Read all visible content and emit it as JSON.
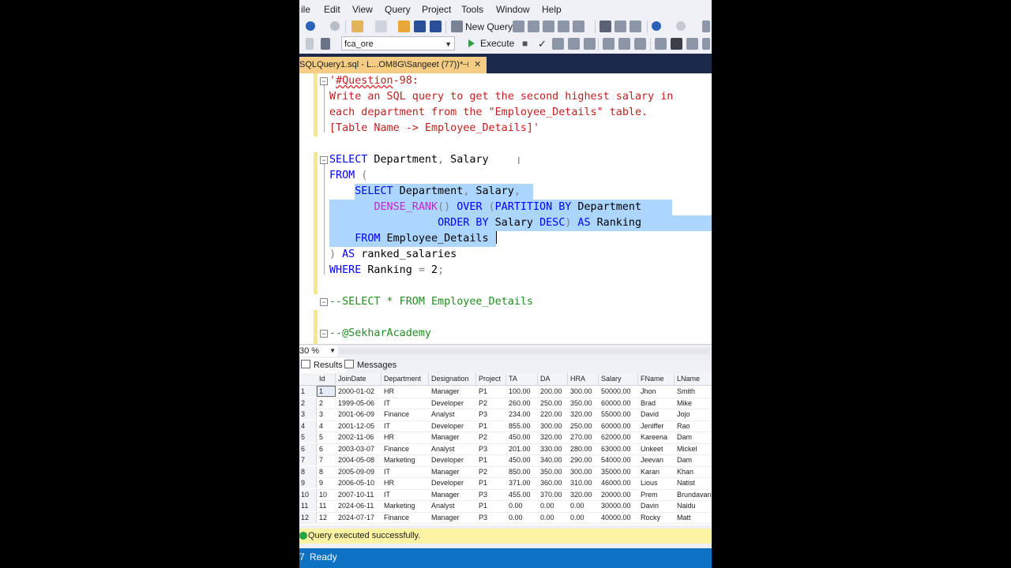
{
  "menu": {
    "items": [
      "ile",
      "Edit",
      "View",
      "Query",
      "Project",
      "Tools",
      "Window",
      "Help"
    ]
  },
  "toolbar": {
    "new_query_label": "New Query",
    "database": "fca_ore",
    "execute_label": "Execute",
    "icons": [
      "back-arrow",
      "forward-arrow",
      "new-file",
      "open-file",
      "save",
      "save-all",
      "new-query",
      "database-query",
      "mdx",
      "dmx",
      "xmla",
      "dax",
      "cut",
      "copy",
      "paste",
      "undo",
      "redo"
    ]
  },
  "document_tab": {
    "title": "SQLQuery1.sql - L...OM8G\\Sangeet (77))*"
  },
  "editor": {
    "lines": [
      {
        "segments": [
          {
            "t": "'",
            "c": "red"
          },
          {
            "t": "#Question",
            "c": "red-wavy"
          },
          {
            "t": "-98:",
            "c": "red"
          }
        ]
      },
      {
        "segments": [
          {
            "t": "Write an SQL query to get the second highest salary in",
            "c": "red"
          }
        ]
      },
      {
        "segments": [
          {
            "t": "each department from the \"Employee_Details\" table.",
            "c": "red"
          }
        ]
      },
      {
        "segments": [
          {
            "t": "[Table Name -> Employee_Details]'",
            "c": "red"
          }
        ]
      },
      {
        "segments": []
      },
      {
        "segments": [
          {
            "t": "SELECT",
            "c": "blue"
          },
          {
            "t": " Department",
            "c": "black"
          },
          {
            "t": ",",
            "c": "gray"
          },
          {
            "t": " Salary",
            "c": "black"
          }
        ]
      },
      {
        "segments": [
          {
            "t": "FROM",
            "c": "blue"
          },
          {
            "t": " (",
            "c": "gray"
          }
        ]
      },
      {
        "segments": [
          {
            "t": "    ",
            "c": "black"
          },
          {
            "t": "SELECT",
            "c": "blue"
          },
          {
            "t": " Department",
            "c": "black"
          },
          {
            "t": ",",
            "c": "gray"
          },
          {
            "t": " Salary",
            "c": "black"
          },
          {
            "t": ",",
            "c": "gray"
          }
        ]
      },
      {
        "segments": [
          {
            "t": "       ",
            "c": "black"
          },
          {
            "t": "DENSE_RANK",
            "c": "pink"
          },
          {
            "t": "()",
            "c": "gray"
          },
          {
            "t": " OVER",
            "c": "blue"
          },
          {
            "t": " (",
            "c": "gray"
          },
          {
            "t": "PARTITION BY",
            "c": "blue"
          },
          {
            "t": " Department",
            "c": "black"
          }
        ]
      },
      {
        "segments": [
          {
            "t": "                 ",
            "c": "black"
          },
          {
            "t": "ORDER BY",
            "c": "blue"
          },
          {
            "t": " Salary ",
            "c": "black"
          },
          {
            "t": "DESC",
            "c": "blue"
          },
          {
            "t": ")",
            "c": "gray"
          },
          {
            "t": " AS",
            "c": "blue"
          },
          {
            "t": " Ranking",
            "c": "black"
          }
        ]
      },
      {
        "segments": [
          {
            "t": "    ",
            "c": "black"
          },
          {
            "t": "FROM",
            "c": "blue"
          },
          {
            "t": " Employee_Details",
            "c": "black"
          }
        ]
      },
      {
        "segments": [
          {
            "t": ")",
            "c": "gray"
          },
          {
            "t": " AS",
            "c": "blue"
          },
          {
            "t": " ranked_salaries",
            "c": "black"
          }
        ]
      },
      {
        "segments": [
          {
            "t": "WHERE",
            "c": "blue"
          },
          {
            "t": " Ranking ",
            "c": "black"
          },
          {
            "t": "=",
            "c": "gray"
          },
          {
            "t": " 2",
            "c": "black"
          },
          {
            "t": ";",
            "c": "gray"
          }
        ]
      },
      {
        "segments": []
      },
      {
        "segments": [
          {
            "t": "--SELECT * FROM Employee_Details",
            "c": "green"
          }
        ]
      },
      {
        "segments": []
      },
      {
        "segments": [
          {
            "t": "--@SekharAcademy",
            "c": "green"
          }
        ]
      }
    ]
  },
  "zoom": {
    "value": "30 %"
  },
  "results_tabs": {
    "results": "Results",
    "messages": "Messages"
  },
  "grid": {
    "columns": [
      "Id",
      "JoinDate",
      "Department",
      "Designation",
      "Project",
      "TA",
      "DA",
      "HRA",
      "Salary",
      "FName",
      "LName"
    ],
    "rows": [
      [
        "1",
        "1",
        "2000-01-02",
        "HR",
        "Manager",
        "P1",
        "100.00",
        "200.00",
        "300.00",
        "50000.00",
        "Jhon",
        "Smith"
      ],
      [
        "2",
        "2",
        "1999-05-06",
        "IT",
        "Developer",
        "P2",
        "260.00",
        "250.00",
        "350.00",
        "60000.00",
        "Brad",
        "Mike"
      ],
      [
        "3",
        "3",
        "2001-06-09",
        "Finance",
        "Analyst",
        "P3",
        "234.00",
        "220.00",
        "320.00",
        "55000.00",
        "David",
        "Jojo"
      ],
      [
        "4",
        "4",
        "2001-12-05",
        "IT",
        "Developer",
        "P1",
        "855.00",
        "300.00",
        "250.00",
        "60000.00",
        "Jeniffer",
        "Rao"
      ],
      [
        "5",
        "5",
        "2002-11-06",
        "HR",
        "Manager",
        "P2",
        "450.00",
        "320.00",
        "270.00",
        "62000.00",
        "Kareena",
        "Dam"
      ],
      [
        "6",
        "6",
        "2003-03-07",
        "Finance",
        "Analyst",
        "P3",
        "201.00",
        "330.00",
        "280.00",
        "63000.00",
        "Unkeet",
        "Mickel"
      ],
      [
        "7",
        "7",
        "2004-05-08",
        "Marketing",
        "Developer",
        "P1",
        "450.00",
        "340.00",
        "290.00",
        "54000.00",
        "Jeevan",
        "Dam"
      ],
      [
        "8",
        "8",
        "2005-09-09",
        "IT",
        "Manager",
        "P2",
        "850.00",
        "350.00",
        "300.00",
        "35000.00",
        "Karan",
        "Khan"
      ],
      [
        "9",
        "9",
        "2006-05-10",
        "HR",
        "Developer",
        "P1",
        "371.00",
        "360.00",
        "310.00",
        "46000.00",
        "Lious",
        "Natist"
      ],
      [
        "10",
        "10",
        "2007-10-11",
        "IT",
        "Manager",
        "P3",
        "455.00",
        "370.00",
        "320.00",
        "20000.00",
        "Prem",
        "Brundavan"
      ],
      [
        "11",
        "11",
        "2024-06-11",
        "Marketing",
        "Analyst",
        "P1",
        "0.00",
        "0.00",
        "0.00",
        "30000.00",
        "Davin",
        "Naidu"
      ],
      [
        "12",
        "12",
        "2024-07-17",
        "Finance",
        "Manager",
        "P3",
        "0.00",
        "0.00",
        "0.00",
        "40000.00",
        "Rocky",
        "Matt"
      ]
    ]
  },
  "status": {
    "message": "Query executed successfully.",
    "ready": "Ready"
  },
  "colors": {
    "accent": "#0e72c4",
    "tab_active": "#f5cc84",
    "selection": "#add6ff",
    "status_bg": "#fcf3a4"
  }
}
